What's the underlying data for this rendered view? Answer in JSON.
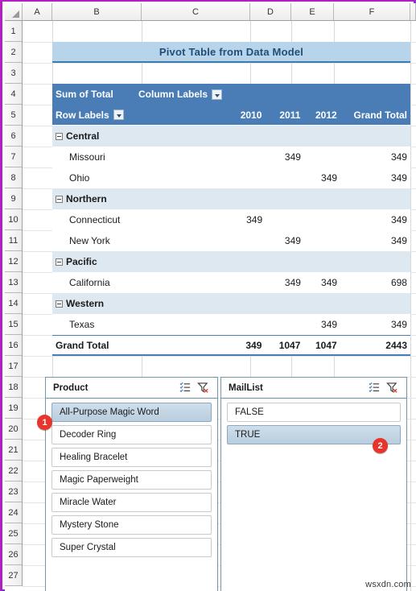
{
  "spreadsheet": {
    "column_headers": [
      "A",
      "B",
      "C",
      "D",
      "E",
      "F"
    ],
    "row_headers": [
      "1",
      "2",
      "3",
      "4",
      "5",
      "6",
      "7",
      "8",
      "9",
      "10",
      "11",
      "12",
      "13",
      "14",
      "15",
      "16",
      "17",
      "18",
      "19",
      "20",
      "21",
      "22",
      "23",
      "24",
      "25",
      "26",
      "27"
    ],
    "title": "Pivot Table from Data Model",
    "watermark": "wsxdn.com"
  },
  "pivot": {
    "value_field_label": "Sum of Total",
    "column_labels_label": "Column Labels",
    "row_labels_label": "Row Labels",
    "column_headers": [
      "2010",
      "2011",
      "2012",
      "Grand Total"
    ],
    "rows": [
      {
        "label": "Central",
        "type": "group",
        "values": [
          "",
          "",
          "",
          ""
        ]
      },
      {
        "label": "Missouri",
        "type": "item",
        "values": [
          "",
          "349",
          "",
          "349"
        ]
      },
      {
        "label": "Ohio",
        "type": "item",
        "values": [
          "",
          "",
          "349",
          "349"
        ]
      },
      {
        "label": "Northern",
        "type": "group",
        "values": [
          "",
          "",
          "",
          ""
        ]
      },
      {
        "label": "Connecticut",
        "type": "item",
        "values": [
          "349",
          "",
          "",
          "349"
        ]
      },
      {
        "label": "New York",
        "type": "item",
        "values": [
          "",
          "349",
          "",
          "349"
        ]
      },
      {
        "label": "Pacific",
        "type": "group",
        "values": [
          "",
          "",
          "",
          ""
        ]
      },
      {
        "label": "California",
        "type": "item",
        "values": [
          "",
          "349",
          "349",
          "698"
        ]
      },
      {
        "label": "Western",
        "type": "group",
        "values": [
          "",
          "",
          "",
          ""
        ]
      },
      {
        "label": "Texas",
        "type": "item",
        "values": [
          "",
          "",
          "349",
          "349"
        ]
      },
      {
        "label": "Grand Total",
        "type": "grand",
        "values": [
          "349",
          "1047",
          "1047",
          "2443"
        ]
      }
    ]
  },
  "slicers": [
    {
      "title": "Product",
      "multiselect_icon": "multi-select-icon",
      "clear_filter_icon": "clear-filter-icon",
      "items": [
        {
          "label": "All-Purpose Magic Word",
          "selected": true
        },
        {
          "label": "Decoder Ring",
          "selected": false
        },
        {
          "label": "Healing Bracelet",
          "selected": false
        },
        {
          "label": "Magic Paperweight",
          "selected": false
        },
        {
          "label": "Miracle Water",
          "selected": false
        },
        {
          "label": "Mystery Stone",
          "selected": false
        },
        {
          "label": "Super Crystal",
          "selected": false
        }
      ]
    },
    {
      "title": "MailList",
      "multiselect_icon": "multi-select-icon",
      "clear_filter_icon": "clear-filter-icon",
      "items": [
        {
          "label": "FALSE",
          "selected": false
        },
        {
          "label": "TRUE",
          "selected": true
        }
      ]
    }
  ],
  "annotations": [
    {
      "label": "1"
    },
    {
      "label": "2"
    }
  ],
  "colors": {
    "pivot_header_fill": "#4a7db5",
    "group_row_fill": "#dde8f1",
    "title_fill": "#b7d4ea",
    "title_text": "#1f4e79",
    "badge": "#e8342a",
    "slicer_border": "#7397a8",
    "selected_item": "#c2d4e3"
  }
}
